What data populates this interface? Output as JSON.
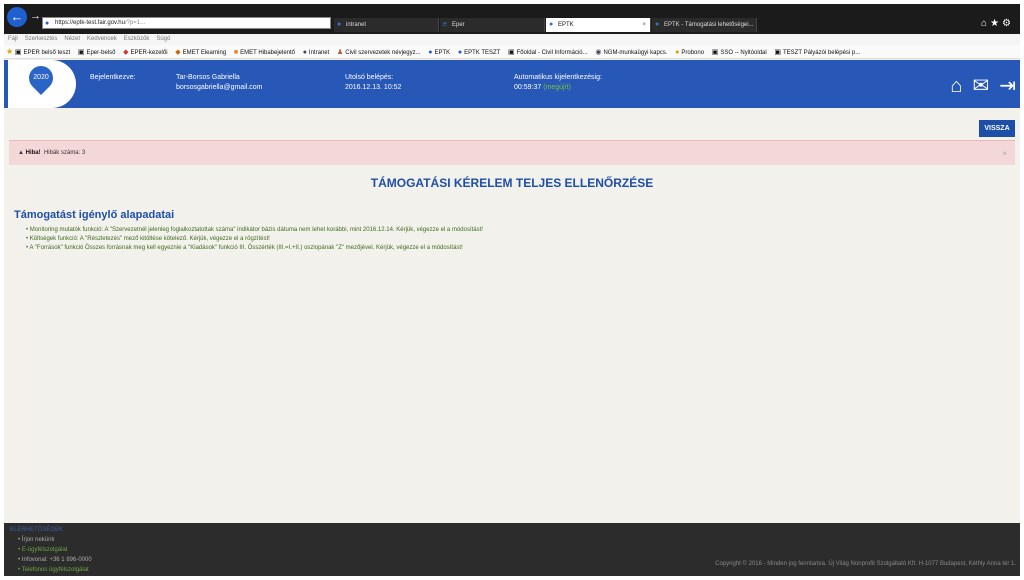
{
  "browser": {
    "url_host": "https://eptk-test.fair.gov.hu",
    "url_rest": "/?p=1...",
    "tabs": [
      "intranet",
      "Eper",
      "EPTK",
      "EPTK - Támogatási lehetőségei..."
    ],
    "menu": [
      "Fájl",
      "Szerkesztés",
      "Nézet",
      "Kedvencek",
      "Eszközök",
      "Súgó"
    ],
    "favorites": [
      "EPER belső teszt",
      "Eper-belső",
      "EPER-kezelői",
      "EMET Elearning",
      "EMET Hibabejelentő",
      "Intranet",
      "Civil szervezetek névjegyz...",
      "EPTK",
      "EPTK TESZT",
      "Főoldal - Civil Információ...",
      "NGM-munkaügyi kapcs.",
      "Probono",
      "SSO -- Nyitóoldal",
      "TESZT Pályázói belépési p..."
    ]
  },
  "header": {
    "logo_text": "2020",
    "logged_in_label": "Bejelentkezve:",
    "user_name": "Tar-Borsos Gabriella",
    "user_email": "borsosgabriella@gmail.com",
    "last_login_label": "Utolsó belépés:",
    "last_login_value": "2016.12.13. 10:52",
    "auto_logout_label": "Automatikus kijelentkezésig:",
    "auto_logout_value": "00:59:37",
    "auto_logout_link": "(megújít)"
  },
  "content": {
    "back_button": "VISSZA",
    "alert_title": "Hiba!",
    "alert_text": "Hibák száma: 3",
    "page_title": "TÁMOGATÁSI KÉRELEM TELJES ELLENŐRZÉSE",
    "section_title": "Támogatást igénylő alapadatai",
    "errors": [
      "Monitoring mutatók funkció: A \"Szervezetnél jelenleg foglalkoztatottak száma\" indikátor bázis dátuma nem lehet korábbi, mint 2016.12.14. Kérjük, végezze el a módosítást!",
      "Költségek funkció: A \"Részletezés\" mező kitöltése kötelező. Kérjük, végezze el a rögzítést!",
      "A \"Források\" funkció Összes forrásnak meg kell egyeznie a \"Kiadások\" funkció III. Összérték (III.=I.+II.) oszlopának \"Z\" mezőjével. Kérjük, végezze el a módosítást!"
    ]
  },
  "footer": {
    "title": "ELÉRHETŐSÉGEK",
    "items": [
      "Írjon nekünk",
      "E-ügyfélszolgálat",
      "Infovonal: +36 1 896-0000",
      "Telefonos ügyfélszolgálat"
    ],
    "copyright": "Copyright © 2016 - Minden jog fenntartva. Új Világ Nonprofit Szolgáltató Kft. H-1077 Budapest, Kéthly Anna tér 1."
  }
}
